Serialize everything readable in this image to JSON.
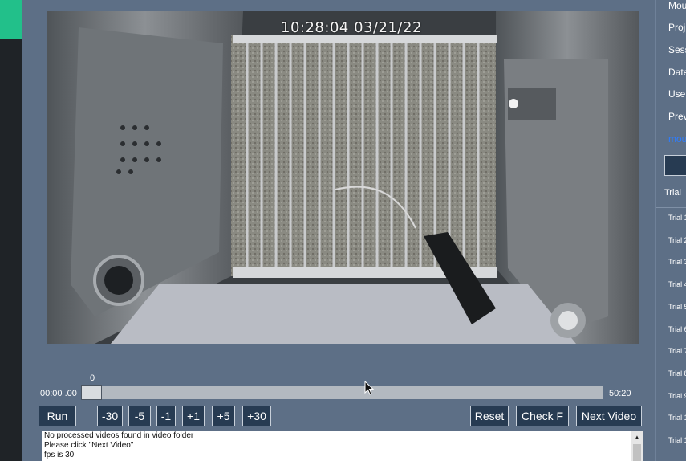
{
  "video": {
    "timestamp": "10:28:04  03/21/22"
  },
  "timeline": {
    "frame_value": "0",
    "current_time": "00:00 .00",
    "total_time": "50:20",
    "position_fraction": 0.0
  },
  "controls": {
    "run": "Run",
    "minus30": "-30",
    "minus5": "-5",
    "minus1": "-1",
    "plus1": "+1",
    "plus5": "+5",
    "plus30": "+30",
    "reset": "Reset",
    "check": "Check F",
    "next_video": "Next Video"
  },
  "log": {
    "lines": [
      "No processed videos found in video folder",
      "Please click \"Next Video\"",
      "fps is 30"
    ]
  },
  "right_panel": {
    "labels": [
      "Mou",
      "Proj",
      "Sess",
      "Date",
      "Use",
      "Prev"
    ],
    "link": "mou",
    "trial_header": "Trial",
    "trials": [
      "Trial 1",
      "Trial 2",
      "Trial 3",
      "Trial 4",
      "Trial 5",
      "Trial 6",
      "Trial 7",
      "Trial 8",
      "Trial 9",
      "Trial 1",
      "Trial 1"
    ]
  },
  "colors": {
    "background": "#5d6f86",
    "button": "#273b52",
    "accent": "#22c08a",
    "link": "#2d7dff"
  }
}
